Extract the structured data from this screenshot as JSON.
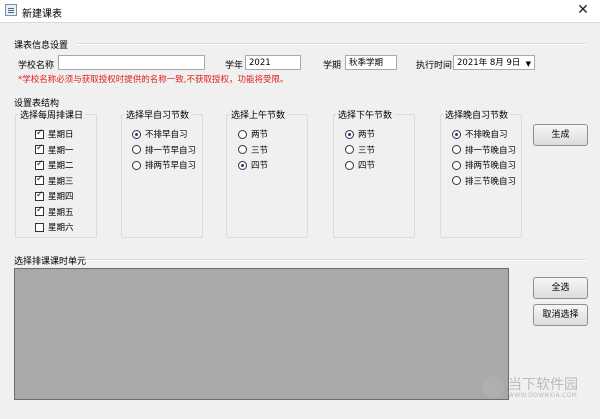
{
  "window": {
    "title": "新建课表",
    "close_glyph": "✕",
    "icon": "app-window-icon"
  },
  "course_info": {
    "section_label": "课表信息设置",
    "school_label": "学校名称",
    "school_value": "",
    "year_label": "学年",
    "year_value": "2021",
    "term_label": "学期",
    "term_value": "秋季学期",
    "exec_label": "执行时间",
    "exec_value": "2021年 8月 9日",
    "warning": "*学校名称必须与获取授权时提供的名称一致,不获取授权，功能将受限。"
  },
  "structure": {
    "section_label": "设置表结构",
    "weekdays": {
      "title": "选择每周排课日",
      "items": [
        {
          "label": "星期日",
          "checked": true
        },
        {
          "label": "星期一",
          "checked": true
        },
        {
          "label": "星期二",
          "checked": true
        },
        {
          "label": "星期三",
          "checked": true
        },
        {
          "label": "星期四",
          "checked": true
        },
        {
          "label": "星期五",
          "checked": true
        },
        {
          "label": "星期六",
          "checked": false
        }
      ]
    },
    "morning_study": {
      "title": "选择早自习节数",
      "items": [
        {
          "label": "不排早自习",
          "checked": true
        },
        {
          "label": "排一节早自习",
          "checked": false
        },
        {
          "label": "排两节早自习",
          "checked": false
        }
      ]
    },
    "am": {
      "title": "选择上午节数",
      "items": [
        {
          "label": "两节",
          "checked": false
        },
        {
          "label": "三节",
          "checked": false
        },
        {
          "label": "四节",
          "checked": true
        }
      ]
    },
    "pm": {
      "title": "选择下午节数",
      "items": [
        {
          "label": "两节",
          "checked": true
        },
        {
          "label": "三节",
          "checked": false
        },
        {
          "label": "四节",
          "checked": false
        }
      ]
    },
    "evening_study": {
      "title": "选择晚自习节数",
      "items": [
        {
          "label": "不排晚自习",
          "checked": true
        },
        {
          "label": "排一节晚自习",
          "checked": false
        },
        {
          "label": "排两节晚自习",
          "checked": false
        },
        {
          "label": "排三节晚自习",
          "checked": false
        }
      ]
    },
    "generate_label": "生成"
  },
  "units": {
    "section_label": "选择排课课时单元",
    "select_all_label": "全选",
    "deselect_label": "取消选择"
  },
  "watermark": {
    "text": "当下软件园",
    "sub": "WWW.DOWNXIA.COM"
  }
}
